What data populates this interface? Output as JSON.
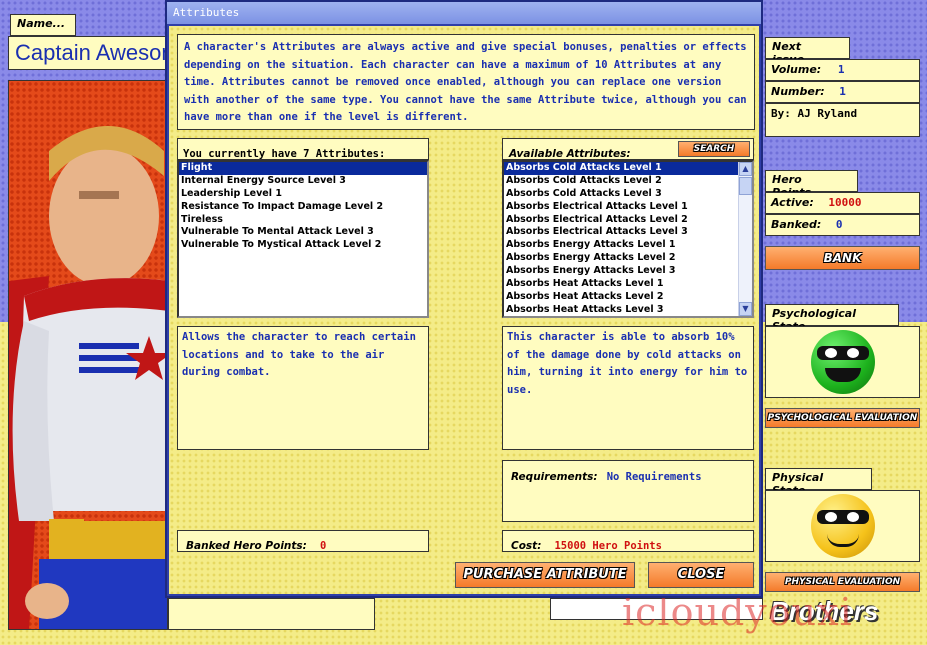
{
  "app": {
    "name_label": "Name...",
    "character_name": "Captain Awesome"
  },
  "issue": {
    "next_issue_label": "Next issue...",
    "volume_label": "Volume:",
    "volume_value": "1",
    "number_label": "Number:",
    "number_value": "1",
    "author": "By: AJ Ryland"
  },
  "hero_points": {
    "label": "Hero Points...",
    "active_label": "Active:",
    "active_value": "10000",
    "banked_label": "Banked:",
    "banked_value": "0",
    "bank_button": "BANK"
  },
  "psych": {
    "label": "Psychological State...",
    "eval_button": "PSYCHOLOGICAL EVALUATION",
    "face_color": "#1db21d"
  },
  "physical": {
    "label": "Physical State...",
    "eval_button": "PHYSICAL EVALUATION",
    "face_color": "#f5c21a"
  },
  "watermark": "icloudyouxi",
  "brand_partial": "Brothers",
  "dialog": {
    "title": "Attributes",
    "intro": "A character's Attributes are always active and give special bonuses, penalties or effects depending on the situation. Each character can have a maximum of 10 Attributes at any time. Attributes cannot be removed once enabled, although you can replace one version with another of the same type. You cannot have the same Attribute twice, although you can have more than one if the level is different.",
    "current_header": "You currently have 7 Attributes:",
    "current_list": [
      "Flight",
      "Internal Energy Source Level 3",
      "Leadership Level 1",
      "Resistance To Impact Damage Level 2",
      "Tireless",
      "Vulnerable To Mental Attack Level 3",
      "Vulnerable To Mystical Attack Level 2"
    ],
    "current_description": "Allows the character to reach certain locations and to take to the air during combat.",
    "available_header": "Available Attributes:",
    "search_button": "SEARCH",
    "available_list": [
      "Absorbs Cold Attacks Level 1",
      "Absorbs Cold Attacks Level 2",
      "Absorbs Cold Attacks Level 3",
      "Absorbs Electrical Attacks Level 1",
      "Absorbs Electrical Attacks Level 2",
      "Absorbs Electrical Attacks Level 3",
      "Absorbs Energy Attacks Level 1",
      "Absorbs Energy Attacks Level 2",
      "Absorbs Energy Attacks Level 3",
      "Absorbs Heat Attacks Level 1",
      "Absorbs Heat Attacks Level 2",
      "Absorbs Heat Attacks Level 3"
    ],
    "available_description": "This character is able to absorb 10% of the damage done by cold attacks on him, turning it into energy for him to use.",
    "requirements_label": "Requirements:",
    "requirements_value": "No Requirements",
    "banked_label": "Banked Hero Points:",
    "banked_value": "0",
    "cost_label": "Cost:",
    "cost_value": "15000 Hero Points",
    "purchase_button": "PURCHASE ATTRIBUTE",
    "close_button": "CLOSE"
  }
}
